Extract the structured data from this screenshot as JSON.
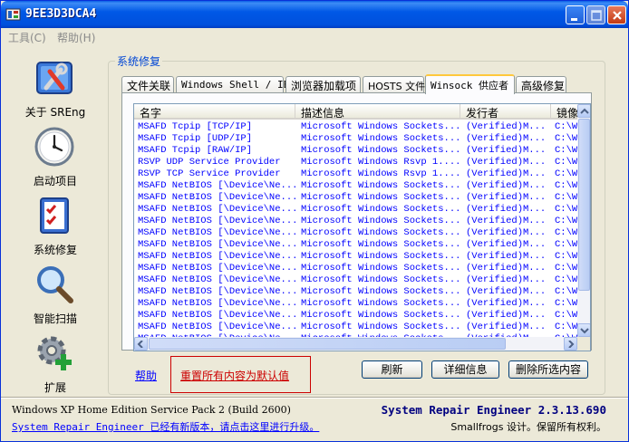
{
  "window": {
    "title": "9EE3D3DCA4"
  },
  "menu": [
    {
      "label": "工具(C)"
    },
    {
      "label": "帮助(H)"
    }
  ],
  "sidebar": {
    "items": [
      {
        "label": "关于 SREng",
        "icon": "tools-icon"
      },
      {
        "label": "启动项目",
        "icon": "clock-icon"
      },
      {
        "label": "系统修复",
        "icon": "checklist-icon"
      },
      {
        "label": "智能扫描",
        "icon": "magnifier-icon"
      },
      {
        "label": "扩展",
        "icon": "gear-plus-icon"
      }
    ]
  },
  "group": {
    "title": "系统修复"
  },
  "tabs": [
    {
      "label": "文件关联"
    },
    {
      "label": "Windows Shell / IE"
    },
    {
      "label": "浏览器加载项"
    },
    {
      "label": "HOSTS 文件"
    },
    {
      "label": "Winsock 供应者",
      "active": true
    },
    {
      "label": "高级修复"
    }
  ],
  "list": {
    "columns": [
      "名字",
      "描述信息",
      "发行者",
      "镜像"
    ],
    "rows": [
      [
        "MSAFD Tcpip [TCP/IP]",
        "Microsoft Windows Sockets...",
        "(Verified)M...",
        "C:\\W"
      ],
      [
        "MSAFD Tcpip [UDP/IP]",
        "Microsoft Windows Sockets...",
        "(Verified)M...",
        "C:\\W"
      ],
      [
        "MSAFD Tcpip [RAW/IP]",
        "Microsoft Windows Sockets...",
        "(Verified)M...",
        "C:\\W"
      ],
      [
        "RSVP UDP Service Provider",
        "Microsoft Windows Rsvp 1....",
        "(Verified)M...",
        "C:\\W"
      ],
      [
        "RSVP TCP Service Provider",
        "Microsoft Windows Rsvp 1....",
        "(Verified)M...",
        "C:\\W"
      ],
      [
        "MSAFD NetBIOS [\\Device\\Ne...",
        "Microsoft Windows Sockets...",
        "(Verified)M...",
        "C:\\W"
      ],
      [
        "MSAFD NetBIOS [\\Device\\Ne...",
        "Microsoft Windows Sockets...",
        "(Verified)M...",
        "C:\\W"
      ],
      [
        "MSAFD NetBIOS [\\Device\\Ne...",
        "Microsoft Windows Sockets...",
        "(Verified)M...",
        "C:\\W"
      ],
      [
        "MSAFD NetBIOS [\\Device\\Ne...",
        "Microsoft Windows Sockets...",
        "(Verified)M...",
        "C:\\W"
      ],
      [
        "MSAFD NetBIOS [\\Device\\Ne...",
        "Microsoft Windows Sockets...",
        "(Verified)M...",
        "C:\\W"
      ],
      [
        "MSAFD NetBIOS [\\Device\\Ne...",
        "Microsoft Windows Sockets...",
        "(Verified)M...",
        "C:\\W"
      ],
      [
        "MSAFD NetBIOS [\\Device\\Ne...",
        "Microsoft Windows Sockets...",
        "(Verified)M...",
        "C:\\W"
      ],
      [
        "MSAFD NetBIOS [\\Device\\Ne...",
        "Microsoft Windows Sockets...",
        "(Verified)M...",
        "C:\\W"
      ],
      [
        "MSAFD NetBIOS [\\Device\\Ne...",
        "Microsoft Windows Sockets...",
        "(Verified)M...",
        "C:\\W"
      ],
      [
        "MSAFD NetBIOS [\\Device\\Ne...",
        "Microsoft Windows Sockets...",
        "(Verified)M...",
        "C:\\W"
      ],
      [
        "MSAFD NetBIOS [\\Device\\Ne...",
        "Microsoft Windows Sockets...",
        "(Verified)M...",
        "C:\\W"
      ],
      [
        "MSAFD NetBIOS [\\Device\\Ne...",
        "Microsoft Windows Sockets...",
        "(Verified)M...",
        "C:\\W"
      ],
      [
        "MSAFD NetBIOS [\\Device\\Ne...",
        "Microsoft Windows Sockets...",
        "(Verified)M...",
        "C:\\W"
      ],
      [
        "MSAFD NetBIOS [\\Device\\Ne...",
        "Microsoft Windows Sockets...",
        "(Verified)M...",
        "C:\\W"
      ]
    ]
  },
  "actions": {
    "help": "帮助",
    "reset_all": "重置所有内容为默认值",
    "refresh": "刷新",
    "details": "详细信息",
    "delete_selected": "删除所选内容"
  },
  "status": {
    "os": "Windows XP Home Edition Service Pack 2 (Build 2600)",
    "update_notice": "System Repair Engineer 已经有新版本，请点击这里进行升级。",
    "version": "System Repair Engineer 2.3.13.690",
    "copyright": "Smallfrogs 设计。保留所有权利。"
  },
  "colors": {
    "title_bar": "#0054e3",
    "group_title": "#0046d5",
    "list_text": "#0000ff",
    "reset_link": "#cc0000"
  }
}
